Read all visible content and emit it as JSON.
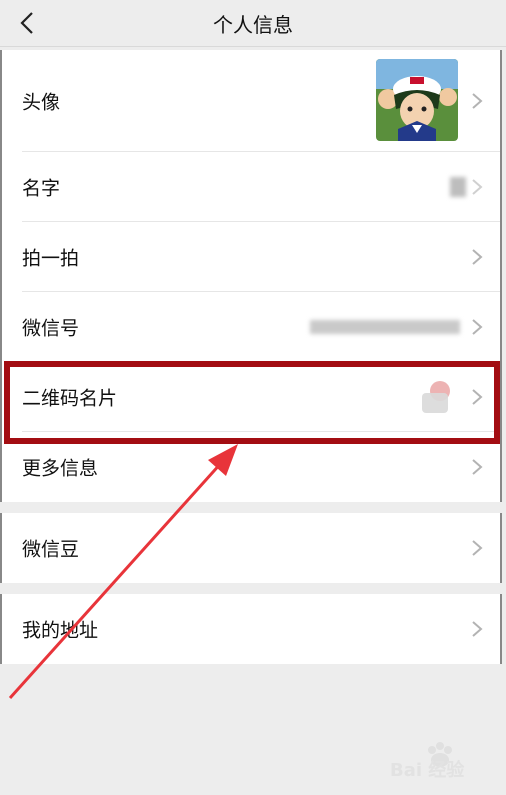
{
  "header": {
    "title": "个人信息"
  },
  "profile": {
    "avatar_label": "头像",
    "name_label": "名字",
    "pat_label": "拍一拍",
    "wechat_id_label": "微信号",
    "qr_label": "二维码名片",
    "more_label": "更多信息"
  },
  "wallet": {
    "beans_label": "微信豆"
  },
  "address": {
    "label": "我的地址"
  },
  "watermark": {
    "text": "Bai 经验"
  },
  "colors": {
    "highlight": "#a30d12",
    "arrow": "#e8343a"
  }
}
